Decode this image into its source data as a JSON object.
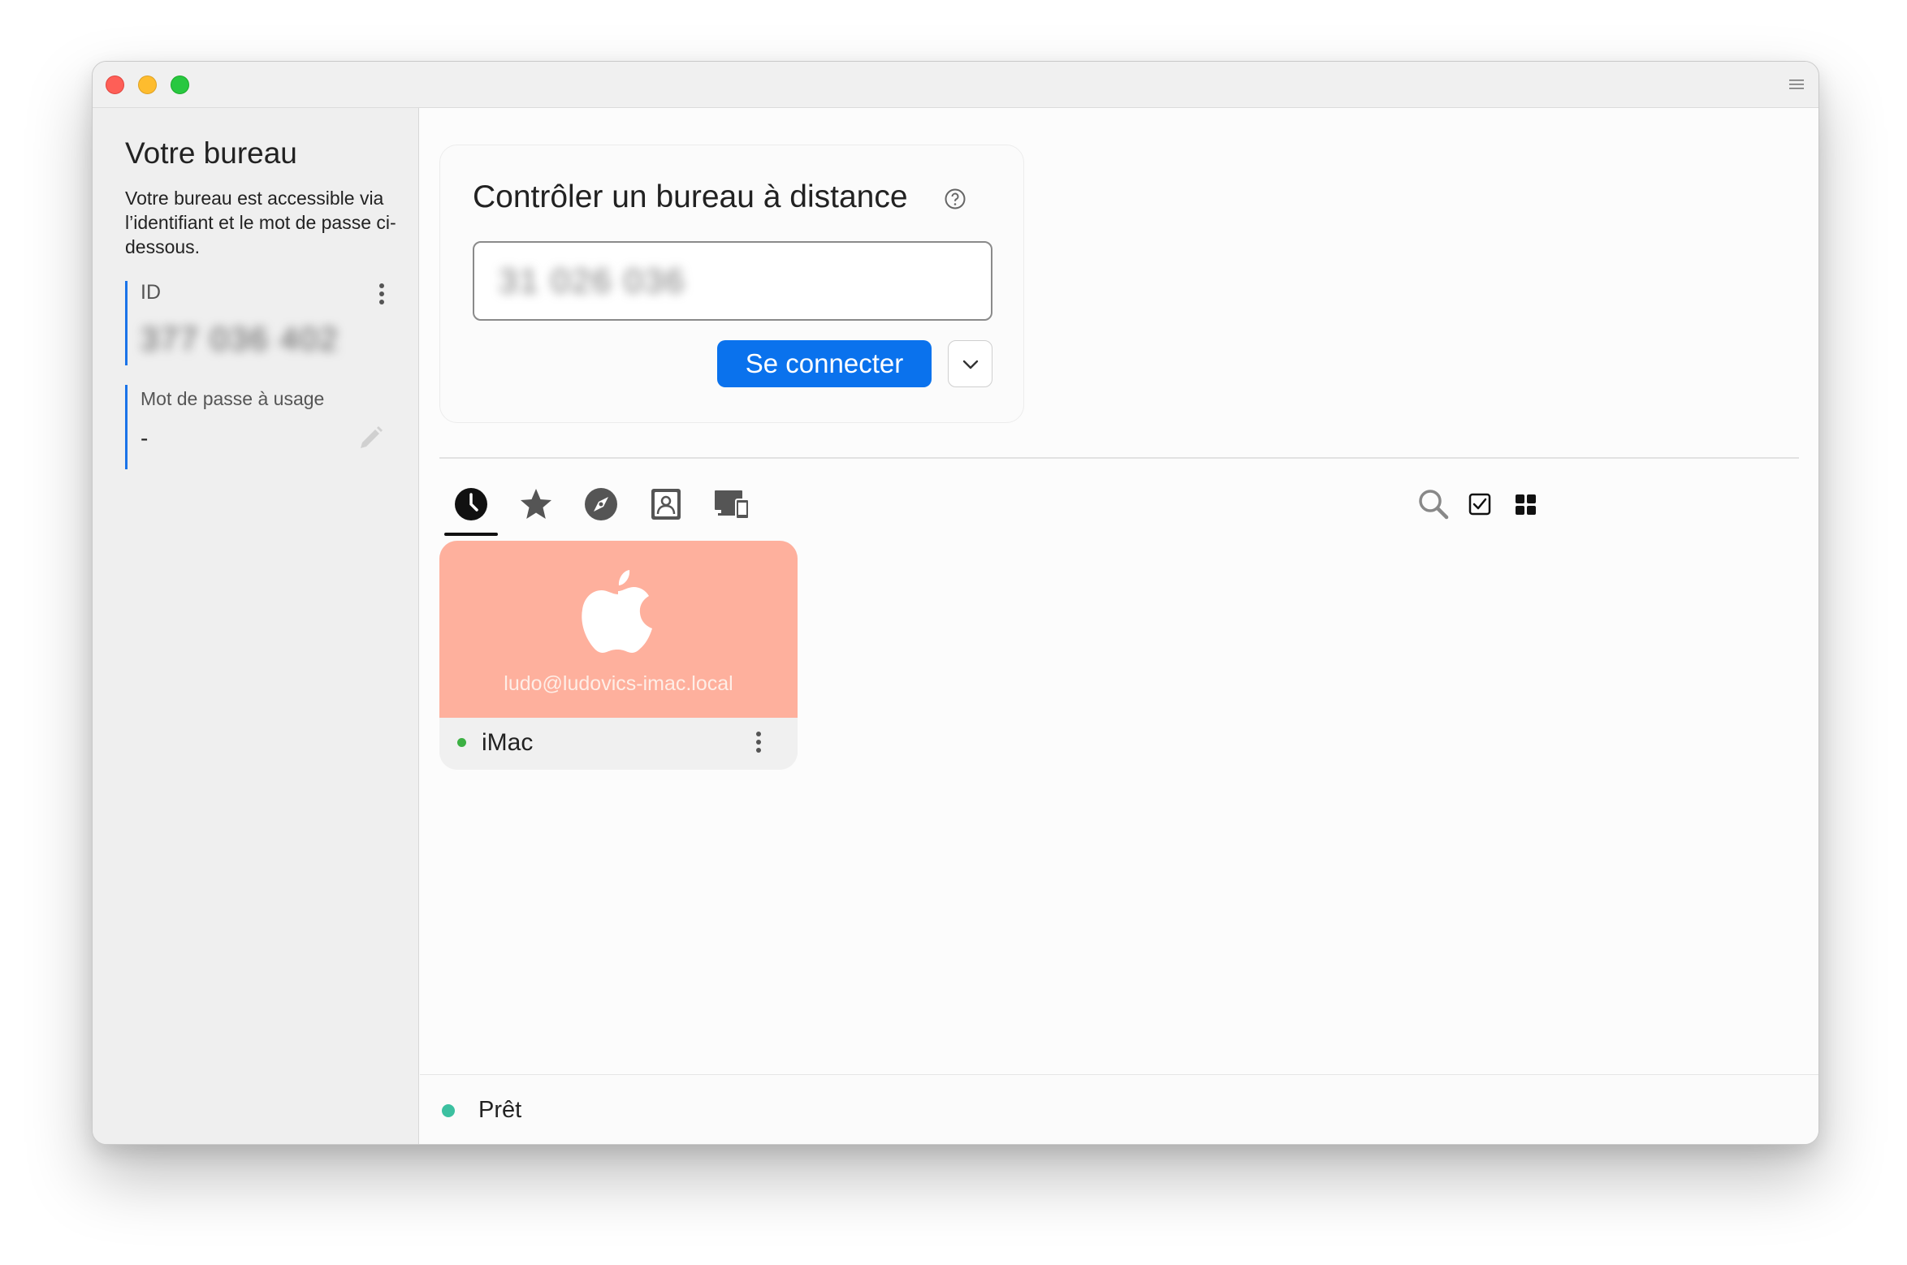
{
  "sidebar": {
    "title": "Votre bureau",
    "description": "Votre bureau est accessible via l’identifiant et le mot de passe ci-dessous.",
    "id_label": "ID",
    "id_value": "377 036 402",
    "password_label": "Mot de passe à usage",
    "password_value": "-"
  },
  "connect": {
    "title": "Contrôler un bureau à distance",
    "input_value": "31 026 036",
    "connect_label": "Se connecter"
  },
  "tabs": [
    {
      "name": "recent-tab",
      "icon": "clock-icon",
      "active": true
    },
    {
      "name": "favorites-tab",
      "icon": "star-icon",
      "active": false
    },
    {
      "name": "discovered-tab",
      "icon": "compass-icon",
      "active": false
    },
    {
      "name": "address-book-tab",
      "icon": "contact-book-icon",
      "active": false
    },
    {
      "name": "devices-tab",
      "icon": "devices-icon",
      "active": false
    }
  ],
  "peers": [
    {
      "user": "ludo@ludovics-imac.local",
      "name": "iMac",
      "os": "apple",
      "online": true,
      "color": "#feb09d"
    }
  ],
  "status": {
    "text": "Prêt",
    "color": "#3cc0a0"
  },
  "colors": {
    "accent": "#0a72ed",
    "sidebar_bg": "#efefef"
  }
}
